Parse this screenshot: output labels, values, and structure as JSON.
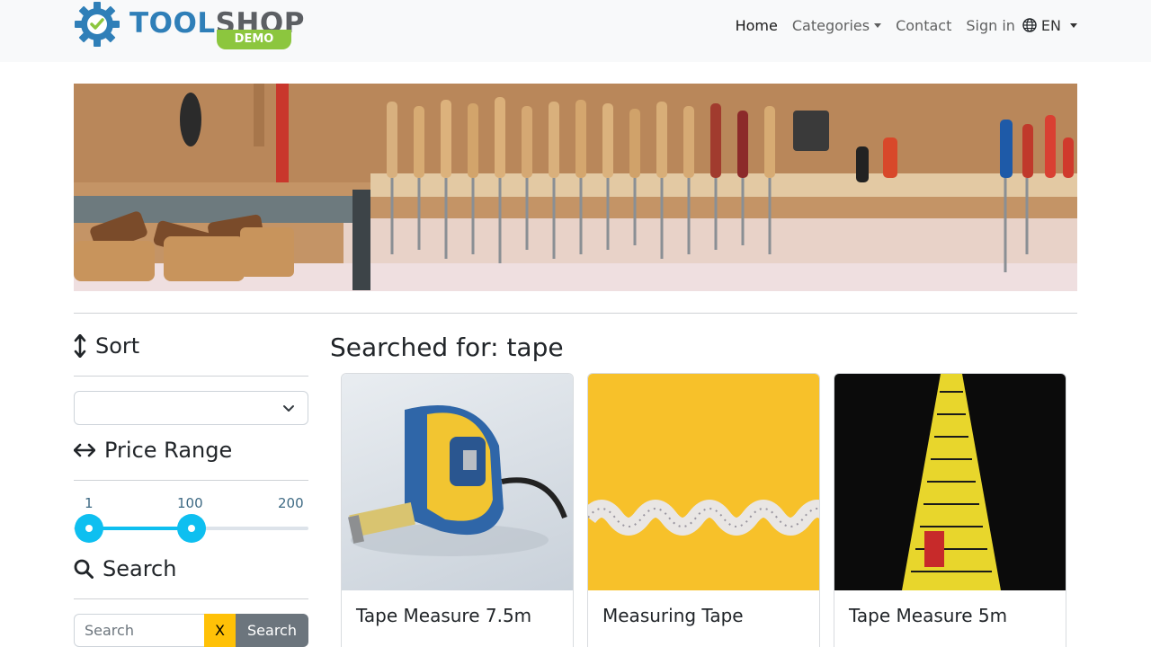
{
  "brand": {
    "logo_part1": "TOOL",
    "logo_part2": "SHOP",
    "badge": "DEMO"
  },
  "nav": {
    "home": "Home",
    "categories": "Categories",
    "contact": "Contact",
    "sign_in": "Sign in",
    "language": "EN"
  },
  "sidebar": {
    "sort_title": "Sort",
    "sort_selected": "",
    "price_title": "Price Range",
    "price_min_label": "1",
    "price_value_label": "100",
    "price_max_label": "200",
    "price_range": {
      "min": 1,
      "max": 200,
      "low": 1,
      "high": 100
    },
    "search_title": "Search",
    "search_placeholder": "Search",
    "search_value": "",
    "clear_label": "X",
    "search_button": "Search"
  },
  "results": {
    "title": "Searched for: tape",
    "products": [
      {
        "name": "Tape Measure 7.5m"
      },
      {
        "name": "Measuring Tape"
      },
      {
        "name": "Tape Measure 5m"
      }
    ]
  },
  "colors": {
    "accent": "#0ebff0",
    "clear_button": "#ffc107",
    "search_button": "#6c757d",
    "logo_blue": "#2f7fb8",
    "logo_green": "#8cc63e"
  }
}
